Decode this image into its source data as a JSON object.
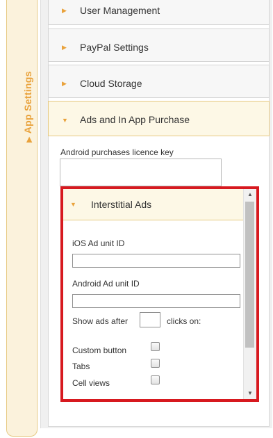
{
  "side_tab": {
    "label": "App Settings",
    "icon": "triangle-right-icon"
  },
  "sections": [
    {
      "label": "User Management",
      "expanded": false
    },
    {
      "label": "PayPal Settings",
      "expanded": false
    },
    {
      "label": "Cloud Storage",
      "expanded": false
    },
    {
      "label": "Ads and In App Purchase",
      "expanded": true
    }
  ],
  "licence": {
    "label": "Android purchases licence key",
    "value": ""
  },
  "interstitial": {
    "header": "Interstitial Ads",
    "ios_label": "iOS Ad unit ID",
    "ios_value": "",
    "android_label": "Android Ad unit ID",
    "android_value": "",
    "show_ads_prefix": "Show ads after",
    "show_ads_value": "",
    "show_ads_suffix": "clicks on:",
    "options": [
      {
        "label": "Custom button",
        "checked": false
      },
      {
        "label": "Tabs",
        "checked": false
      },
      {
        "label": "Cell views",
        "checked": false
      }
    ]
  },
  "colors": {
    "accent": "#e9a23b",
    "highlight": "#d7191f",
    "active_bg": "#fdf8e6"
  }
}
